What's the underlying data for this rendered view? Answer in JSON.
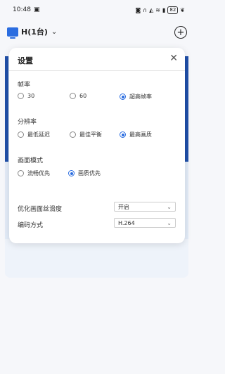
{
  "status": {
    "time": "10:48",
    "battery": "82"
  },
  "header": {
    "device_name": "H(1台)"
  },
  "dialog": {
    "title": "设置",
    "frame_rate": {
      "label": "帧率",
      "options": [
        "30",
        "60",
        "超高帧率"
      ],
      "selected": 2
    },
    "resolution": {
      "label": "分辨率",
      "options": [
        "最低延迟",
        "最佳平衡",
        "最高画质"
      ],
      "selected": 2
    },
    "picture_mode": {
      "label": "画面模式",
      "options": [
        "流畅优先",
        "画质优先"
      ],
      "selected": 1
    },
    "smoothness": {
      "label": "优化画面丝滑度",
      "value": "开启"
    },
    "encoding": {
      "label": "编码方式",
      "value": "H.264"
    }
  }
}
